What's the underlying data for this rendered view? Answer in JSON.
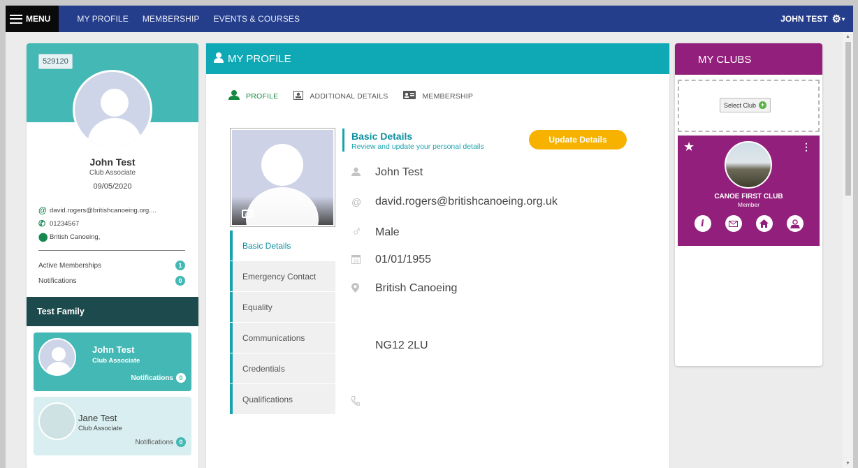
{
  "topnav": {
    "menu_label": "MENU",
    "links": [
      "MY PROFILE",
      "MEMBERSHIP",
      "EVENTS & COURSES"
    ],
    "user_name": "JOHN TEST",
    "user_caret": "▾",
    "gear_glyph": "⚙"
  },
  "profile_card": {
    "member_id": "529120",
    "name": "John Test",
    "role": "Club Associate",
    "date": "09/05/2020",
    "email": "david.rogers@britishcanoeing.org....",
    "phone": "01234567",
    "location": "British Canoeing,",
    "active_memberships_label": "Active Memberships",
    "active_memberships_count": "1",
    "notifications_label": "Notifications",
    "notifications_count": "0"
  },
  "family": {
    "title": "Test Family",
    "members": [
      {
        "name": "John Test",
        "role": "Club Associate",
        "notifications_label": "Notifications",
        "notifications_count": "0"
      },
      {
        "name": "Jane Test",
        "role": "Club Associate",
        "notifications_label": "Notifications",
        "notifications_count": "0"
      }
    ]
  },
  "main": {
    "title": "MY PROFILE",
    "tabs": [
      "PROFILE",
      "ADDITIONAL DETAILS",
      "MEMBERSHIP"
    ],
    "side_nav": [
      "Basic Details",
      "Emergency Contact",
      "Equality",
      "Communications",
      "Credentials",
      "Qualifications"
    ],
    "section_title": "Basic Details",
    "section_subtitle": "Review and update your personal details",
    "update_button": "Update Details",
    "details": {
      "name": "John Test",
      "email": "david.rogers@britishcanoeing.org.uk",
      "gender": "Male",
      "dob": "01/01/1955",
      "address": "British Canoeing",
      "postcode": "NG12 2LU"
    }
  },
  "clubs": {
    "title": "MY CLUBS",
    "select_label": "Select Club",
    "club_name": "CANOE FIRST CLUB",
    "club_role": "Member",
    "star_glyph": "★",
    "menu_glyph": "⋮"
  },
  "colors": {
    "nav_bg": "#253e8c",
    "teal": "#43b8b4",
    "main_header": "#0fa8b5",
    "club_purple": "#931f7c",
    "update_orange": "#f7b200",
    "dark_family": "#1d4a4c"
  }
}
